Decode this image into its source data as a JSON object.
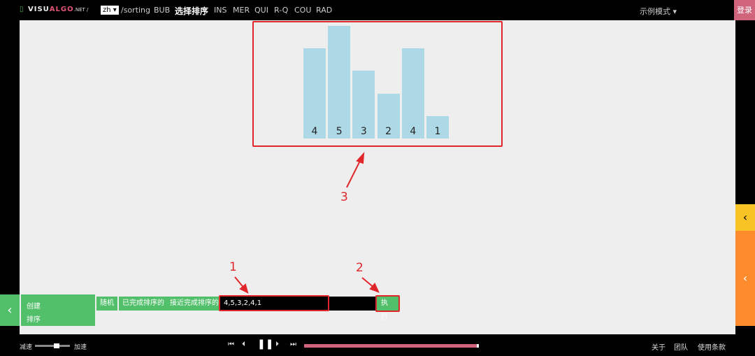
{
  "topbar": {
    "logo_prefix": "VISU",
    "logo_accent": "ALGO",
    "logo_suffix": ".NET /",
    "lang": "zh ▾",
    "path": "/sorting",
    "nav": [
      "BUB",
      "选择排序",
      "INS",
      "MER",
      "QUI",
      "R-Q",
      "COU",
      "RAD"
    ],
    "mode": "示例模式 ▾",
    "login": "登录"
  },
  "bars": [
    4,
    5,
    3,
    2,
    4,
    1
  ],
  "bar_color": "#add8e6",
  "controls": {
    "create": "创建",
    "sort": "排序",
    "random": "随机",
    "sorted": "已完成排序的",
    "nearly_sorted": "接近完成排序的",
    "input_value": "4,5,3,2,4,1",
    "go": "执行"
  },
  "annotations": {
    "one": "1",
    "two": "2",
    "three": "3"
  },
  "bottom": {
    "slow": "减速",
    "fast": "加速",
    "speed": 0.7,
    "progress": 1.0,
    "about": "关于",
    "team": "团队",
    "terms": "使用条款"
  },
  "colors": {
    "green": "#52bf6a",
    "pink": "#d0647c",
    "yellow": "#f7c325",
    "orange": "#fe8c2e",
    "annotation": "#e0262a"
  }
}
